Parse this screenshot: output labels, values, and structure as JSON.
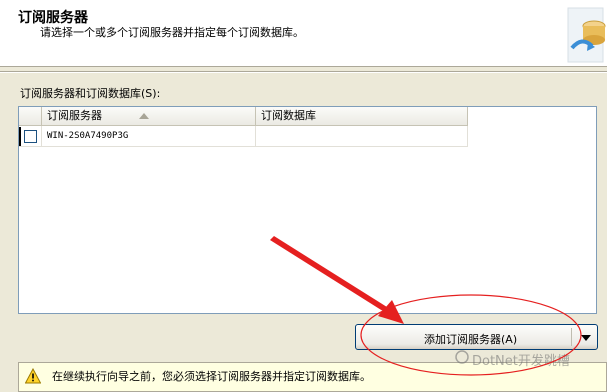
{
  "header": {
    "title": "订阅服务器",
    "subtitle": "请选择一个或多个订阅服务器并指定每个订阅数据库。"
  },
  "grid": {
    "label": "订阅服务器和订阅数据库(S):",
    "columns": [
      "订阅服务器",
      "订阅数据库"
    ],
    "rows": [
      {
        "checked": false,
        "server": "WIN-2S0A7490P3G",
        "database": ""
      }
    ]
  },
  "add_button": {
    "label": "添加订阅服务器(A)"
  },
  "info_bar": {
    "text": "在继续执行向导之前，您必须选择订阅服务器并指定订阅数据库。"
  },
  "watermark": {
    "text": "DotNet开发跳槽"
  },
  "colors": {
    "annotation": "#e52020",
    "info_background": "#ffffe1"
  }
}
